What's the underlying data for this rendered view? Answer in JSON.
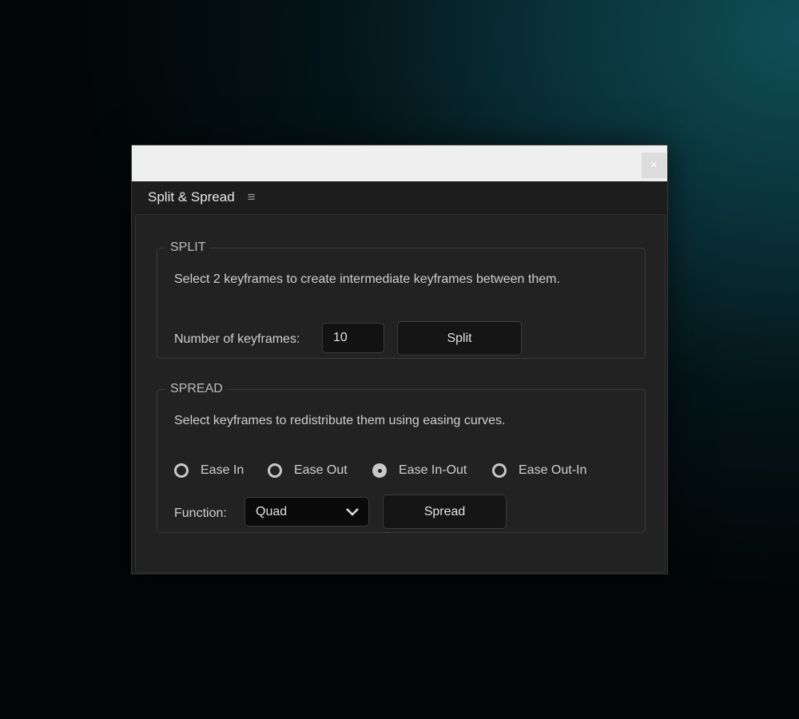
{
  "window": {
    "close_label": "×",
    "tab_title": "Split & Spread",
    "menu_icon": "≡"
  },
  "split": {
    "legend": "SPLIT",
    "description": "Select 2 keyframes to create intermediate keyframes between them.",
    "count_label": "Number of keyframes:",
    "count_value": "10",
    "button": "Split"
  },
  "spread": {
    "legend": "SPREAD",
    "description": "Select keyframes to redistribute them using easing curves.",
    "options": [
      {
        "label": "Ease In",
        "checked": false
      },
      {
        "label": "Ease Out",
        "checked": false
      },
      {
        "label": "Ease In-Out",
        "checked": true
      },
      {
        "label": "Ease Out-In",
        "checked": false
      }
    ],
    "function_label": "Function:",
    "function_value": "Quad",
    "button": "Spread"
  }
}
